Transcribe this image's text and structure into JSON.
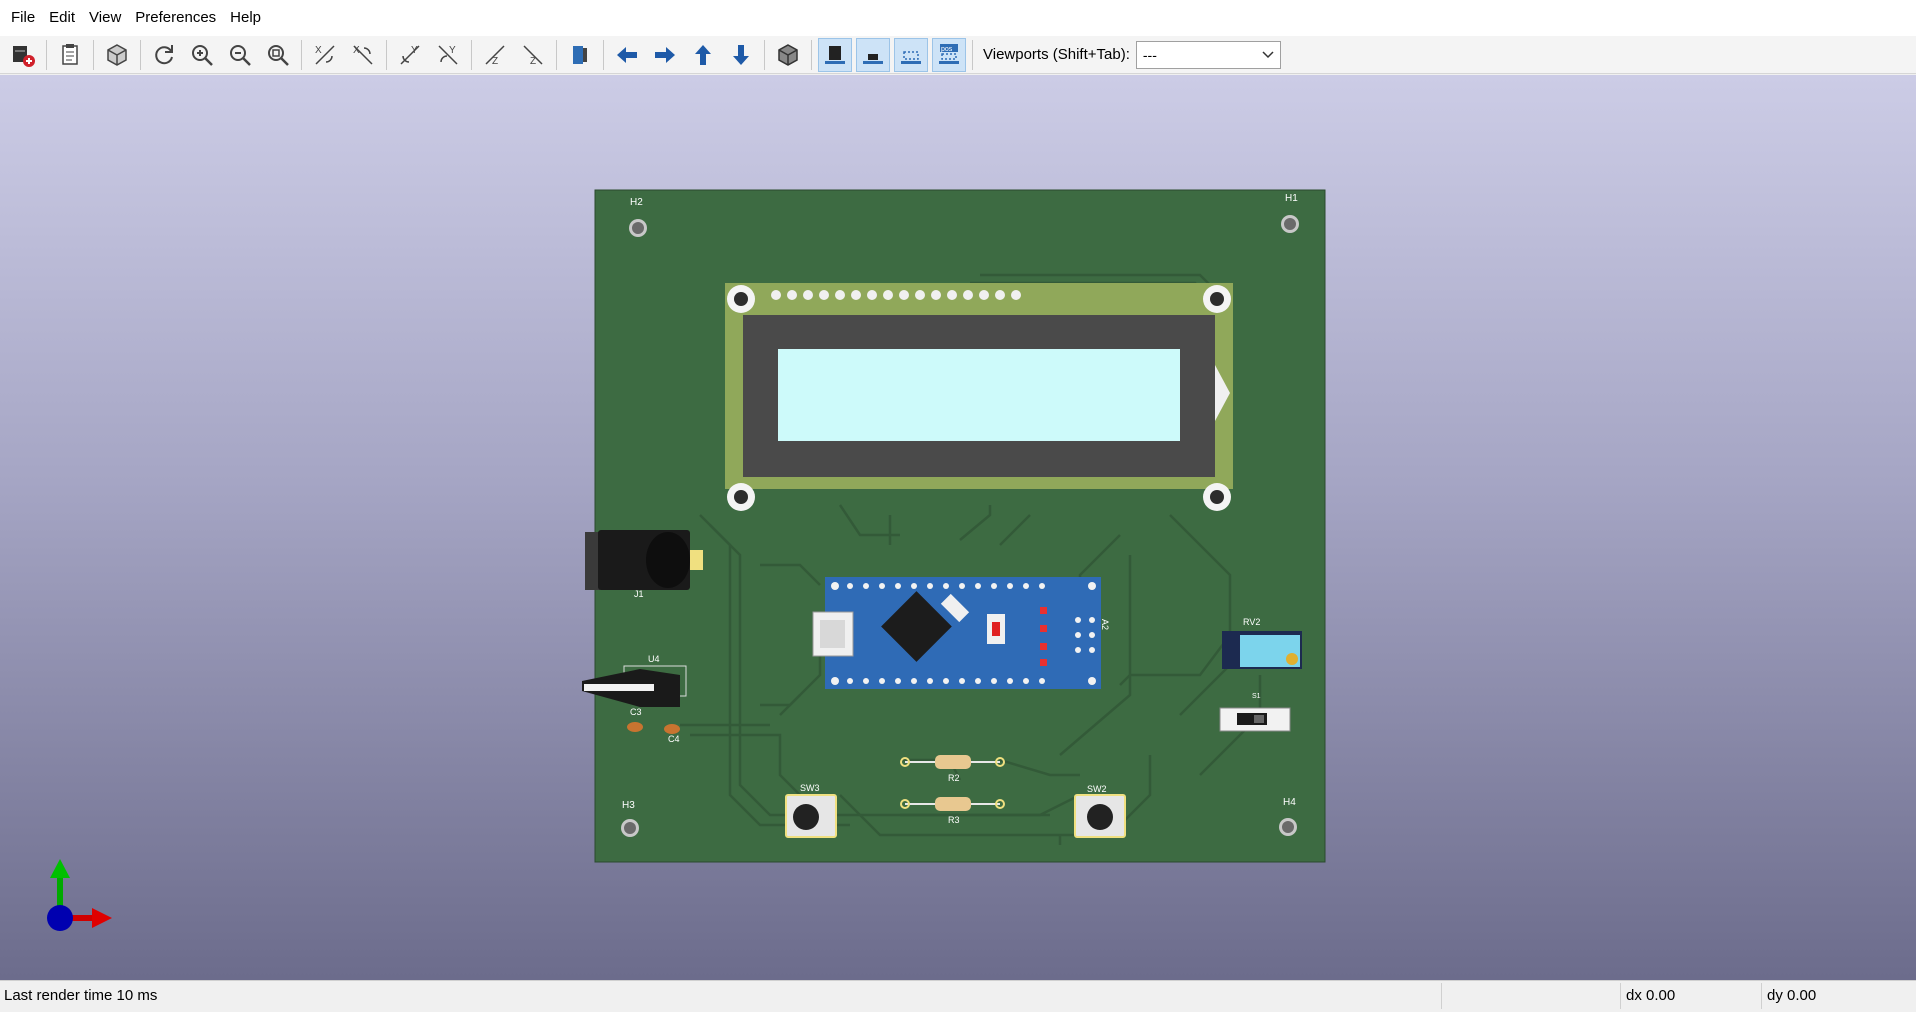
{
  "menu": {
    "file": "File",
    "edit": "Edit",
    "view": "View",
    "preferences": "Preferences",
    "help": "Help"
  },
  "toolbar": {
    "viewports_label": "Viewports (Shift+Tab):",
    "viewports_value": "---",
    "icons": [
      "export-image-icon",
      "copy-clipboard-icon",
      "render-toggle-icon",
      "reload-icon",
      "zoom-in-icon",
      "zoom-out-icon",
      "zoom-fit-icon",
      "rotate-x-cw-icon",
      "rotate-x-ccw-icon",
      "rotate-y-cw-icon",
      "rotate-y-ccw-icon",
      "rotate-z-cw-icon",
      "rotate-z-ccw-icon",
      "flip-board-icon",
      "move-left-icon",
      "move-right-icon",
      "move-up-icon",
      "move-down-icon",
      "ortho-perspective-icon",
      "show-tht-icon",
      "show-smd-icon",
      "show-virtual-icon",
      "show-not-in-pos-icon"
    ]
  },
  "pcb": {
    "labels": {
      "h1": "H1",
      "h2": "H2",
      "h3": "H3",
      "h4": "H4",
      "j1": "J1",
      "u4": "U4",
      "c3": "C3",
      "c4": "C4",
      "rv2": "RV2",
      "s1": "S1",
      "sw2": "SW2",
      "sw3": "SW3",
      "r2": "R2",
      "r3": "R3",
      "a2": "A2"
    },
    "colors": {
      "board": "#3d6b42",
      "lcd_pcb": "#90a85a",
      "lcd_bezel": "#4a4a4a",
      "lcd_screen": "#cdfafa",
      "arduino": "#2f6bb6"
    }
  },
  "status": {
    "render_time": "Last render time 10 ms",
    "dx": "dx 0.00",
    "dy": "dy 0.00"
  }
}
